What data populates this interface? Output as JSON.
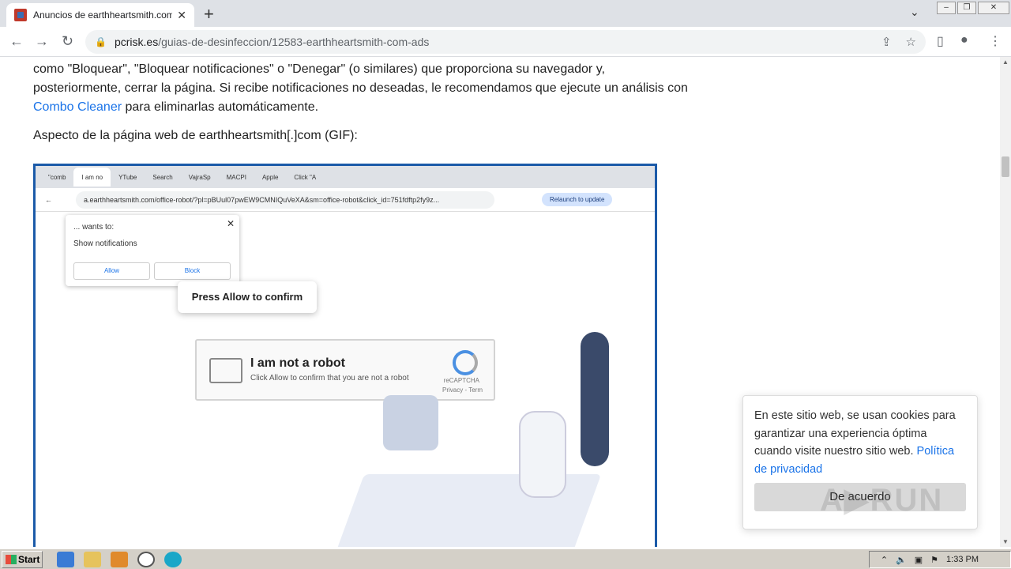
{
  "browser": {
    "tab_title": "Anuncios de earthheartsmith.com - E",
    "tab_close": "✕",
    "new_tab": "+",
    "url_domain": "pcrisk.es",
    "url_path": "/guias-de-desinfeccion/12583-earthheartsmith-com-ads"
  },
  "article": {
    "para1_a": "como \"Bloquear\", \"Bloquear notificaciones\" o \"Denegar\" (o similares) que proporciona su navegador y, posteriormente, cerrar la página. Si recibe notificaciones no deseadas, le recomendamos que ejecute un análisis con ",
    "para1_link": "Combo Cleaner",
    "para1_b": " para eliminarlas automáticamente.",
    "para2": "Aspecto de la página web de earthheartsmith[.]com (GIF):"
  },
  "gif": {
    "tabs": [
      "\"comb",
      "I am no",
      "YTube",
      "Search",
      "VajraSp",
      "MACPI",
      "Apple",
      "Click \"A"
    ],
    "url": "a.earthheartsmith.com/office-robot/?pl=pBUul07pwEW9CMNIQuVeXA&sm=office-robot&click_id=751fdftp2fy9z...",
    "relaunch": "Relaunch to update",
    "notif_wants": "... wants to:",
    "notif_show": "Show notifications",
    "allow": "Allow",
    "block": "Block",
    "press_allow": "Press Allow to confirm",
    "robot_title": "I am not a robot",
    "robot_sub": "Click Allow to confirm that you are not a robot",
    "recaptcha": "reCAPTCHA",
    "privacy": "Privacy - Term"
  },
  "cookie": {
    "text": "En este sitio web, se usan cookies para garantizar una experiencia óptima cuando visite nuestro sitio web. ",
    "link": "Política de privacidad",
    "button": "De acuerdo"
  },
  "watermark": "ANY.RUN",
  "taskbar": {
    "start": "Start",
    "time": "1:33 PM"
  }
}
